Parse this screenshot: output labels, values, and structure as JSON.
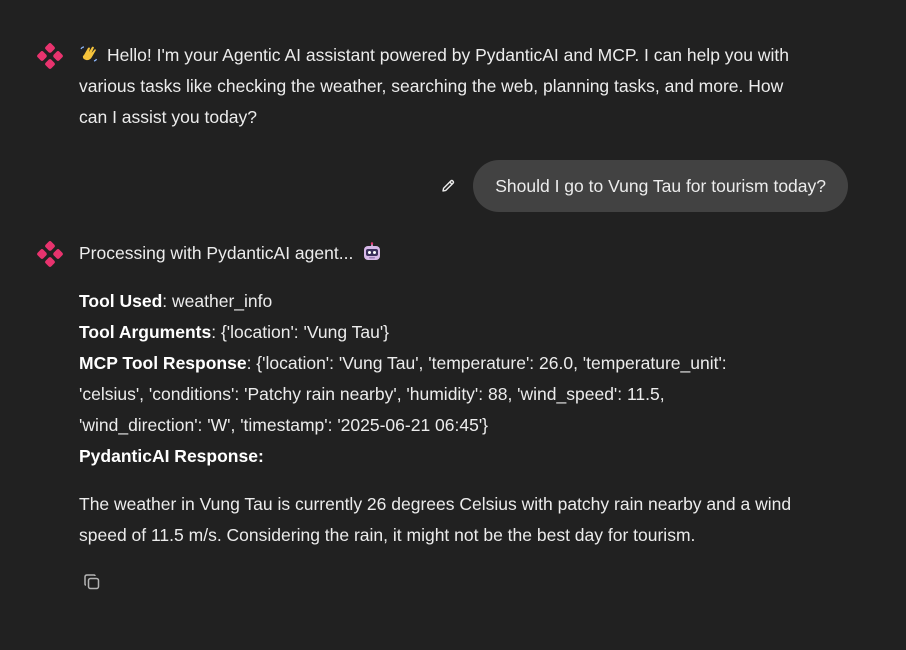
{
  "assistant_greeting": {
    "emoji": "waving-hand",
    "text": "Hello! I'm your Agentic AI assistant powered by PydanticAI and MCP. I can help you with various tasks like checking the weather, searching the web, planning tasks, and more. How can I assist you today?",
    "lines": [
      "Hello! I'm your Agentic AI assistant powered by PydanticAI and MCP. I can help you with",
      "various tasks like checking the weather, searching the web, planning tasks, and more. How",
      "can I assist you today?"
    ]
  },
  "user_message": {
    "text": "Should I go to Vung Tau for tourism today?",
    "edit_icon": "pencil-icon"
  },
  "assistant_response": {
    "processing_text": "Processing with PydanticAI agent...",
    "processing_emoji": "robot-face",
    "tool_used_label": "Tool Used",
    "tool_used_value": ": weather_info",
    "tool_args_label": "Tool Arguments",
    "tool_args_value": ": {'location': 'Vung Tau'}",
    "mcp_label": "MCP Tool Response",
    "mcp_lines": [
      ": {'location': 'Vung Tau', 'temperature': 26.0, 'temperature_unit':",
      "'celsius', 'conditions': 'Patchy rain nearby', 'humidity': 88, 'wind_speed': 11.5,",
      "'wind_direction': 'W', 'timestamp': '2025-06-21 06:45'}"
    ],
    "pydantic_label": "PydanticAI Response:",
    "final_lines": [
      "The weather in Vung Tau is currently 26 degrees Celsius with patchy rain nearby and a wind",
      "speed of 11.5 m/s. Considering the rain, it might not be the best day for tourism."
    ],
    "copy_icon": "copy-icon"
  },
  "colors": {
    "background": "#212121",
    "user_bubble": "#424242",
    "text": "#ececec",
    "avatar_accent": "#e8336e"
  }
}
